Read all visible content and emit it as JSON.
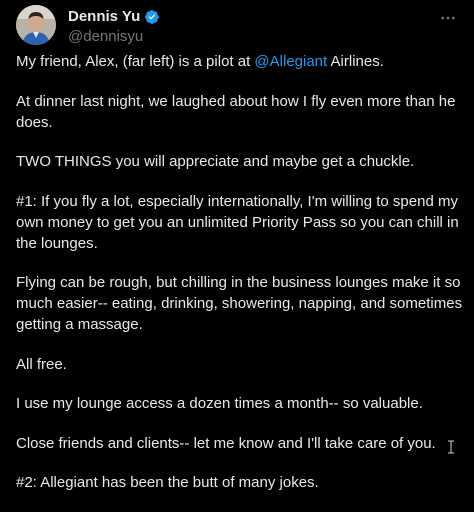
{
  "author": {
    "display_name": "Dennis Yu",
    "handle": "@dennisyu",
    "verified_color": "#1d9bf0"
  },
  "menu": {
    "more_icon": "more-horizontal-icon"
  },
  "tweet": {
    "p1_before": "My friend, Alex, (far left) is a pilot at ",
    "p1_mention": "@Allegiant",
    "p1_after": " Airlines.",
    "p2": "At dinner last night, we laughed about how I fly even more than he does.",
    "p3": "TWO THINGS you will appreciate and maybe get a chuckle.",
    "p4": "#1: If you fly a lot, especially internationally, I'm willing to spend my own money to get you an unlimited Priority Pass so you can chill in the lounges.",
    "p5": "Flying can be rough, but chilling in the business lounges make it so much easier-- eating, drinking, showering, napping, and sometimes getting a massage.",
    "p6": "All free.",
    "p7": "I use my lounge access a dozen times a month-- so valuable.",
    "p8": "Close friends and clients-- let me know and I'll take care of you.",
    "p9": "#2: Allegiant has been the butt of many jokes."
  },
  "colors": {
    "background": "#000000",
    "text": "#e7e9ea",
    "secondary": "#71767b",
    "link": "#1d9bf0"
  }
}
